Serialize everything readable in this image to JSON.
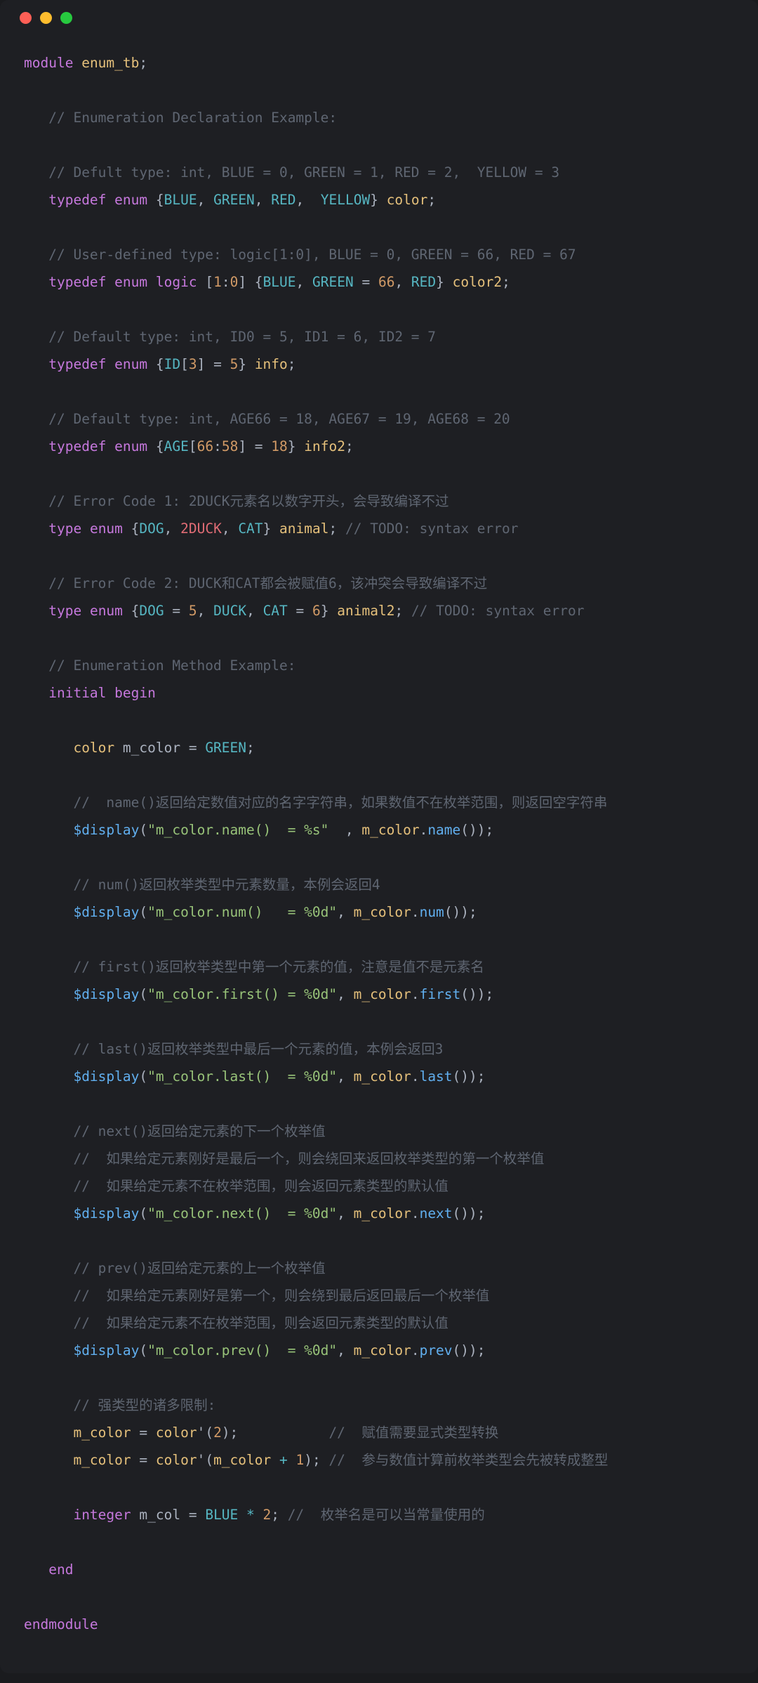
{
  "lines": {
    "l1_kw1": "module",
    "l1_id": "enum_tb",
    "l1_p": ";",
    "c1": "// Enumeration Declaration Example:",
    "c2": "// Defult type: int, BLUE = 0, GREEN = 1, RED = 2,  YELLOW = 3",
    "l3_kw1": "typedef",
    "l3_kw2": "enum",
    "l3_lb": "{",
    "l3_e1": "BLUE",
    "l3_c1": ", ",
    "l3_e2": "GREEN",
    "l3_c2": ", ",
    "l3_e3": "RED",
    "l3_c3": ",  ",
    "l3_e4": "YELLOW",
    "l3_rb": "}",
    "l3_id": " color",
    "l3_p": ";",
    "c3": "// User-defined type: logic[1:0], BLUE = 0, GREEN = 66, RED = 67",
    "l4_kw1": "typedef",
    "l4_kw2": "enum",
    "l4_kw3": "logic",
    "l4_br": " [",
    "l4_n1": "1",
    "l4_col": ":",
    "l4_n2": "0",
    "l4_br2": "] {",
    "l4_e1": "BLUE",
    "l4_c1": ", ",
    "l4_e2": "GREEN",
    "l4_eq": " = ",
    "l4_n3": "66",
    "l4_c2": ", ",
    "l4_e3": "RED",
    "l4_rb": "}",
    "l4_id": " color2",
    "l4_p": ";",
    "c4": "// Default type: int, ID0 = 5, ID1 = 6, ID2 = 7",
    "l5_kw1": "typedef",
    "l5_kw2": "enum",
    "l5_lb": " {",
    "l5_e1": "ID",
    "l5_br": "[",
    "l5_n1": "3",
    "l5_br2": "] = ",
    "l5_n2": "5",
    "l5_rb": "}",
    "l5_id": " info",
    "l5_p": ";",
    "c5": "// Default type: int, AGE66 = 18, AGE67 = 19, AGE68 = 20",
    "l6_kw1": "typedef",
    "l6_kw2": "enum",
    "l6_lb": " {",
    "l6_e1": "AGE",
    "l6_br": "[",
    "l6_n1": "66",
    "l6_col": ":",
    "l6_n2": "58",
    "l6_br2": "] = ",
    "l6_n3": "18",
    "l6_rb": "}",
    "l6_id": " info2",
    "l6_p": ";",
    "c6": "// Error Code 1: 2DUCK元素名以数字开头，会导致编译不过",
    "l7_kw1": "type",
    "l7_kw2": "enum",
    "l7_lb": " {",
    "l7_e1": "DOG",
    "l7_c1": ", ",
    "l7_e2": "2DUCK",
    "l7_c2": ", ",
    "l7_e3": "CAT",
    "l7_rb": "}",
    "l7_id": " animal",
    "l7_p": "; ",
    "l7_cmt": "// TODO: syntax error",
    "c7": "// Error Code 2: DUCK和CAT都会被赋值6，该冲突会导致编译不过",
    "l8_kw1": "type",
    "l8_kw2": "enum",
    "l8_lb": " {",
    "l8_e1": "DOG",
    "l8_eq1": " = ",
    "l8_n1": "5",
    "l8_c1": ", ",
    "l8_e2": "DUCK",
    "l8_c2": ", ",
    "l8_e3": "CAT",
    "l8_eq2": " = ",
    "l8_n2": "6",
    "l8_rb": "}",
    "l8_id": " animal2",
    "l8_p": "; ",
    "l8_cmt": "// TODO: syntax error",
    "c8": "// Enumeration Method Example:",
    "l9_kw1": "initial",
    "l9_kw2": "begin",
    "l10_t": "color",
    "l10_id": " m_color",
    "l10_eq": " = ",
    "l10_v": "GREEN",
    "l10_p": ";",
    "c9": "//  name()返回给定数值对应的名字字符串，如果数值不在枚举范围，则返回空字符串",
    "l11_fn": "$display",
    "l11_lp": "(",
    "l11_s": "\"m_color.name()  = %s\"",
    "l11_c": "  , ",
    "l11_obj": "m_color",
    "l11_dot": ".",
    "l11_m": "name",
    "l11_pp": "());",
    "c10": "// num()返回枚举类型中元素数量，本例会返回4",
    "l12_fn": "$display",
    "l12_lp": "(",
    "l12_s": "\"m_color.num()   = %0d\"",
    "l12_c": ", ",
    "l12_obj": "m_color",
    "l12_dot": ".",
    "l12_m": "num",
    "l12_pp": "());",
    "c11": "// first()返回枚举类型中第一个元素的值，注意是值不是元素名",
    "l13_fn": "$display",
    "l13_lp": "(",
    "l13_s": "\"m_color.first() = %0d\"",
    "l13_c": ", ",
    "l13_obj": "m_color",
    "l13_dot": ".",
    "l13_m": "first",
    "l13_pp": "());",
    "c12": "// last()返回枚举类型中最后一个元素的值，本例会返回3",
    "l14_fn": "$display",
    "l14_lp": "(",
    "l14_s": "\"m_color.last()  = %0d\"",
    "l14_c": ", ",
    "l14_obj": "m_color",
    "l14_dot": ".",
    "l14_m": "last",
    "l14_pp": "());",
    "c13": "// next()返回给定元素的下一个枚举值",
    "c13b": "//  如果给定元素刚好是最后一个，则会绕回来返回枚举类型的第一个枚举值",
    "c13c": "//  如果给定元素不在枚举范围，则会返回元素类型的默认值",
    "l15_fn": "$display",
    "l15_lp": "(",
    "l15_s": "\"m_color.next()  = %0d\"",
    "l15_c": ", ",
    "l15_obj": "m_color",
    "l15_dot": ".",
    "l15_m": "next",
    "l15_pp": "());",
    "c14": "// prev()返回给定元素的上一个枚举值",
    "c14b": "//  如果给定元素刚好是第一个，则会绕到最后返回最后一个枚举值",
    "c14c": "//  如果给定元素不在枚举范围，则会返回元素类型的默认值",
    "l16_fn": "$display",
    "l16_lp": "(",
    "l16_s": "\"m_color.prev()  = %0d\"",
    "l16_c": ", ",
    "l16_obj": "m_color",
    "l16_dot": ".",
    "l16_m": "prev",
    "l16_pp": "());",
    "c15": "// 强类型的诸多限制:",
    "l17_id": "m_color",
    "l17_eq": " = ",
    "l17_t": "color",
    "l17_q": "'(",
    "l17_n": "2",
    "l17_rp": ");           ",
    "l17_cmt": "//  赋值需要显式类型转换",
    "l18_id": "m_color",
    "l18_eq": " = ",
    "l18_t": "color",
    "l18_q": "'(",
    "l18_obj": "m_color",
    "l18_op": " + ",
    "l18_n": "1",
    "l18_rp": "); ",
    "l18_cmt": "//  参与数值计算前枚举类型会先被转成整型",
    "l19_kw": "integer",
    "l19_id": " m_col",
    "l19_eq": " = ",
    "l19_e": "BLUE",
    "l19_op": " * ",
    "l19_n": "2",
    "l19_p": "; ",
    "l19_cmt": "//  枚举名是可以当常量使用的",
    "l20_kw": "end",
    "l21_kw": "endmodule"
  }
}
